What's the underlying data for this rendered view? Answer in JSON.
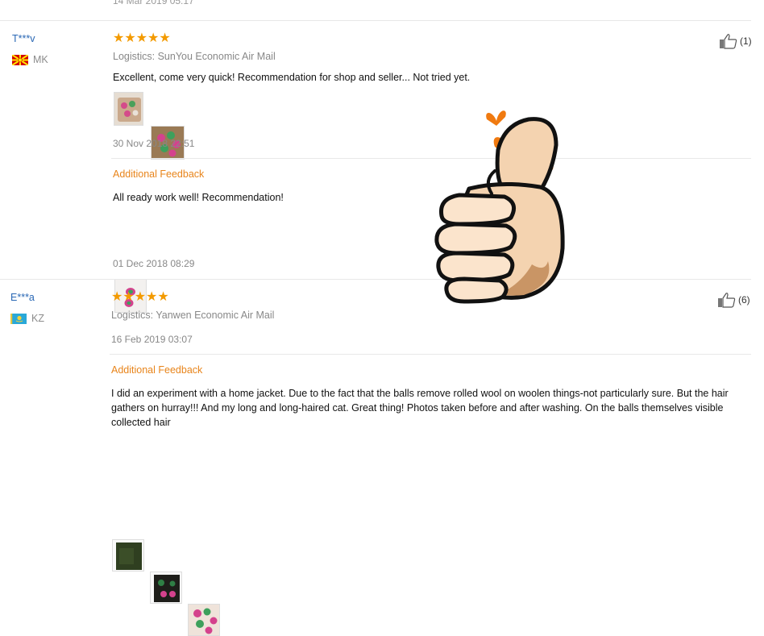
{
  "previous_review": {
    "date": "14 Mar 2019 05:17"
  },
  "reviews": [
    {
      "user": "T***v",
      "country": "MK",
      "stars": "★★★★★",
      "logistics": "Logistics: SunYou Economic Air Mail",
      "text": "Excellent, come very quick! Recommendation for shop and seller... Not tried yet.",
      "date": "30 Nov 2018 22:51",
      "likes": "(1)",
      "additional": {
        "label": "Additional Feedback",
        "text": "All ready work well! Recommendation!",
        "date": "01 Dec 2018 08:29"
      }
    },
    {
      "user": "E***a",
      "country": "KZ",
      "stars": "★★★★★",
      "logistics": "Logistics: Yanwen Economic Air Mail",
      "date": "16 Feb 2019 03:07",
      "likes": "(6)",
      "additional": {
        "label": "Additional Feedback",
        "text": "I did an experiment with a home jacket. Due to the fact that the balls remove rolled wool on woolen things-not particularly sure. But the hair gathers on hurray!!! And my long and long-haired cat. Great thing! Photos taken before and after washing. On the balls themselves visible collected hair"
      }
    }
  ],
  "colors": {
    "accent": "#f39a00",
    "link": "#2a68b5",
    "feedback": "#e8841a",
    "heart": "#f07a10"
  }
}
